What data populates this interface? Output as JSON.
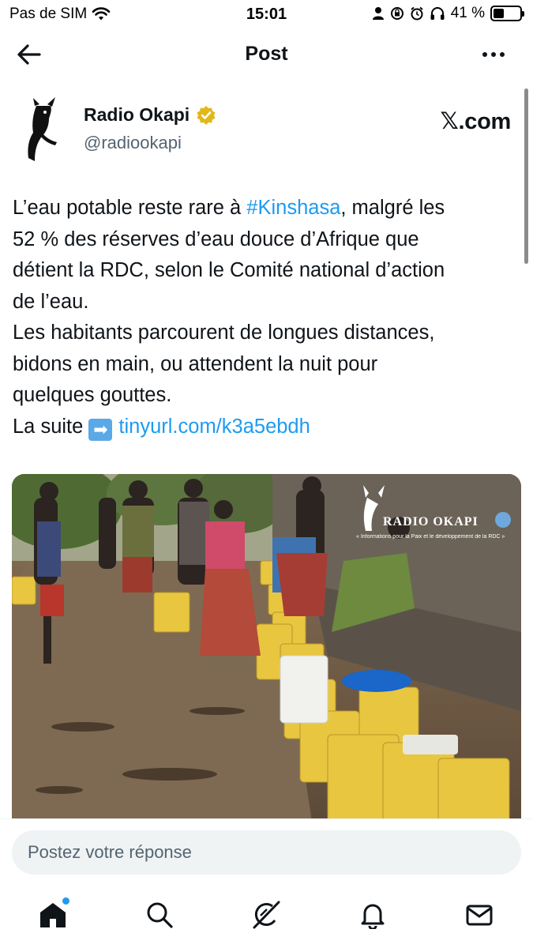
{
  "status_bar": {
    "carrier": "Pas de SIM",
    "time": "15:01",
    "battery_percent": "41 %",
    "battery_level": 0.41
  },
  "header": {
    "title": "Post",
    "back_icon": "arrow-left-icon",
    "more_icon": "more-horizontal-icon"
  },
  "author": {
    "name": "Radio Okapi",
    "handle": "@radiookapi",
    "verified_badge_color": "#e2b719",
    "source": "𝕏.com"
  },
  "tweet": {
    "lines": [
      {
        "before": "L’eau potable reste rare à ",
        "hashtag": "#Kinshasa",
        "after": ", malgré les"
      },
      {
        "text": "52 % des réserves d’eau douce d’Afrique que"
      },
      {
        "text": "détient la RDC, selon le Comité national d’action"
      },
      {
        "text": "de l’eau."
      },
      {
        "text": "Les habitants parcourent de longues distances,"
      },
      {
        "text": "bidons en main, ou attendent la nuit pour"
      },
      {
        "text": "quelques gouttes."
      },
      {
        "before": "La suite ",
        "emoji": "➡",
        "link": "tinyurl.com/k3a5ebdh"
      }
    ]
  },
  "image": {
    "watermark_title": "RADIO OKAPI",
    "watermark_subtitle": "« Informations pour la Paix et le développement de la RDC »"
  },
  "reply": {
    "placeholder": "Postez votre réponse"
  },
  "nav": [
    {
      "icon": "home-icon",
      "active": true,
      "notification_dot": true
    },
    {
      "icon": "search-icon"
    },
    {
      "icon": "grok-icon"
    },
    {
      "icon": "bell-icon"
    },
    {
      "icon": "mail-icon"
    }
  ],
  "colors": {
    "link": "#1d9bf0",
    "text": "#0f1419",
    "secondary": "#536471"
  }
}
